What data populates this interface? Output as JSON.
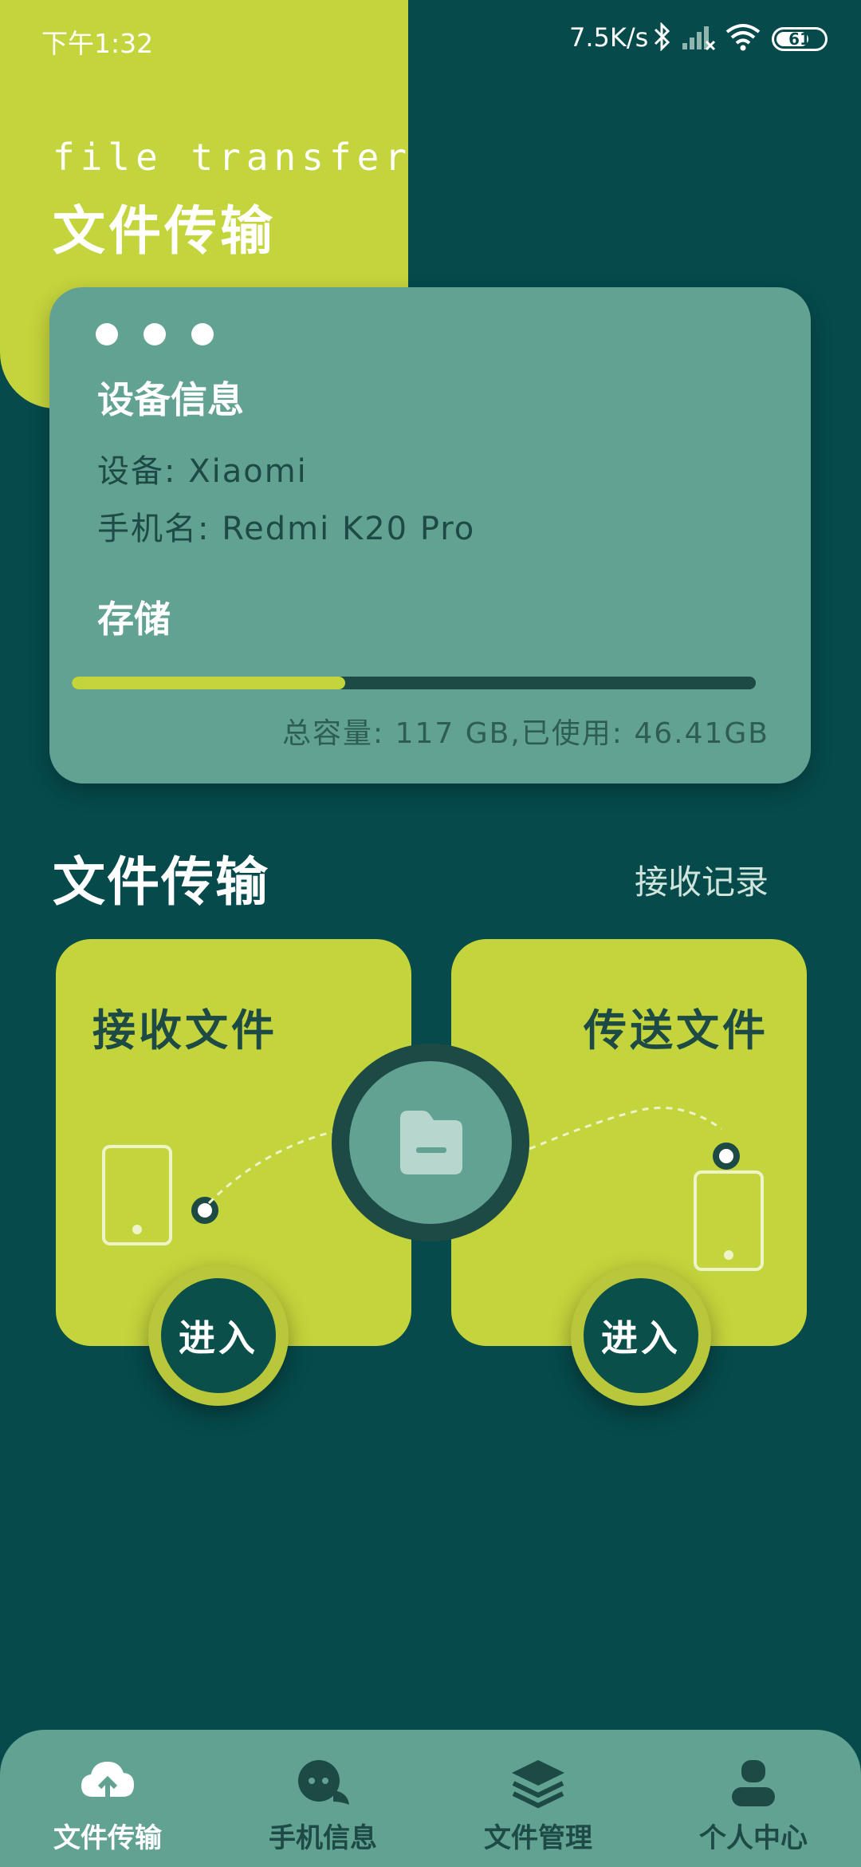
{
  "status_bar": {
    "time": "下午1:32",
    "speed": "7.5K/s",
    "battery": "61",
    "icons": [
      "bluetooth-icon",
      "signal-icon",
      "wifi-icon",
      "battery-icon"
    ]
  },
  "header": {
    "subtitle": "file transfer",
    "title": "文件传输"
  },
  "device_card": {
    "title": "设备信息",
    "device_line": "设备: Xiaomi",
    "phone_name_line": "手机名: Redmi K20 Pro",
    "storage_title": "存储",
    "storage_used_fraction": 0.4,
    "capacity_text": "总容量: 117 GB,已使用: 46.41GB"
  },
  "transfer": {
    "section_title": "文件传输",
    "history_link": "接收记录",
    "receive_title": "接收文件",
    "send_title": "传送文件",
    "enter_label": "进入",
    "center_icon": "folder-icon"
  },
  "nav": {
    "items": [
      {
        "label": "文件传输",
        "icon": "cloud-upload-icon",
        "active": true
      },
      {
        "label": "手机信息",
        "icon": "chat-bubbles-icon",
        "active": false
      },
      {
        "label": "文件管理",
        "icon": "layers-icon",
        "active": false
      },
      {
        "label": "个人中心",
        "icon": "person-icon",
        "active": false
      }
    ]
  },
  "colors": {
    "background": "#064a4c",
    "accent": "#c4d43c",
    "card": "#62a293",
    "dark": "#1d4a44"
  }
}
